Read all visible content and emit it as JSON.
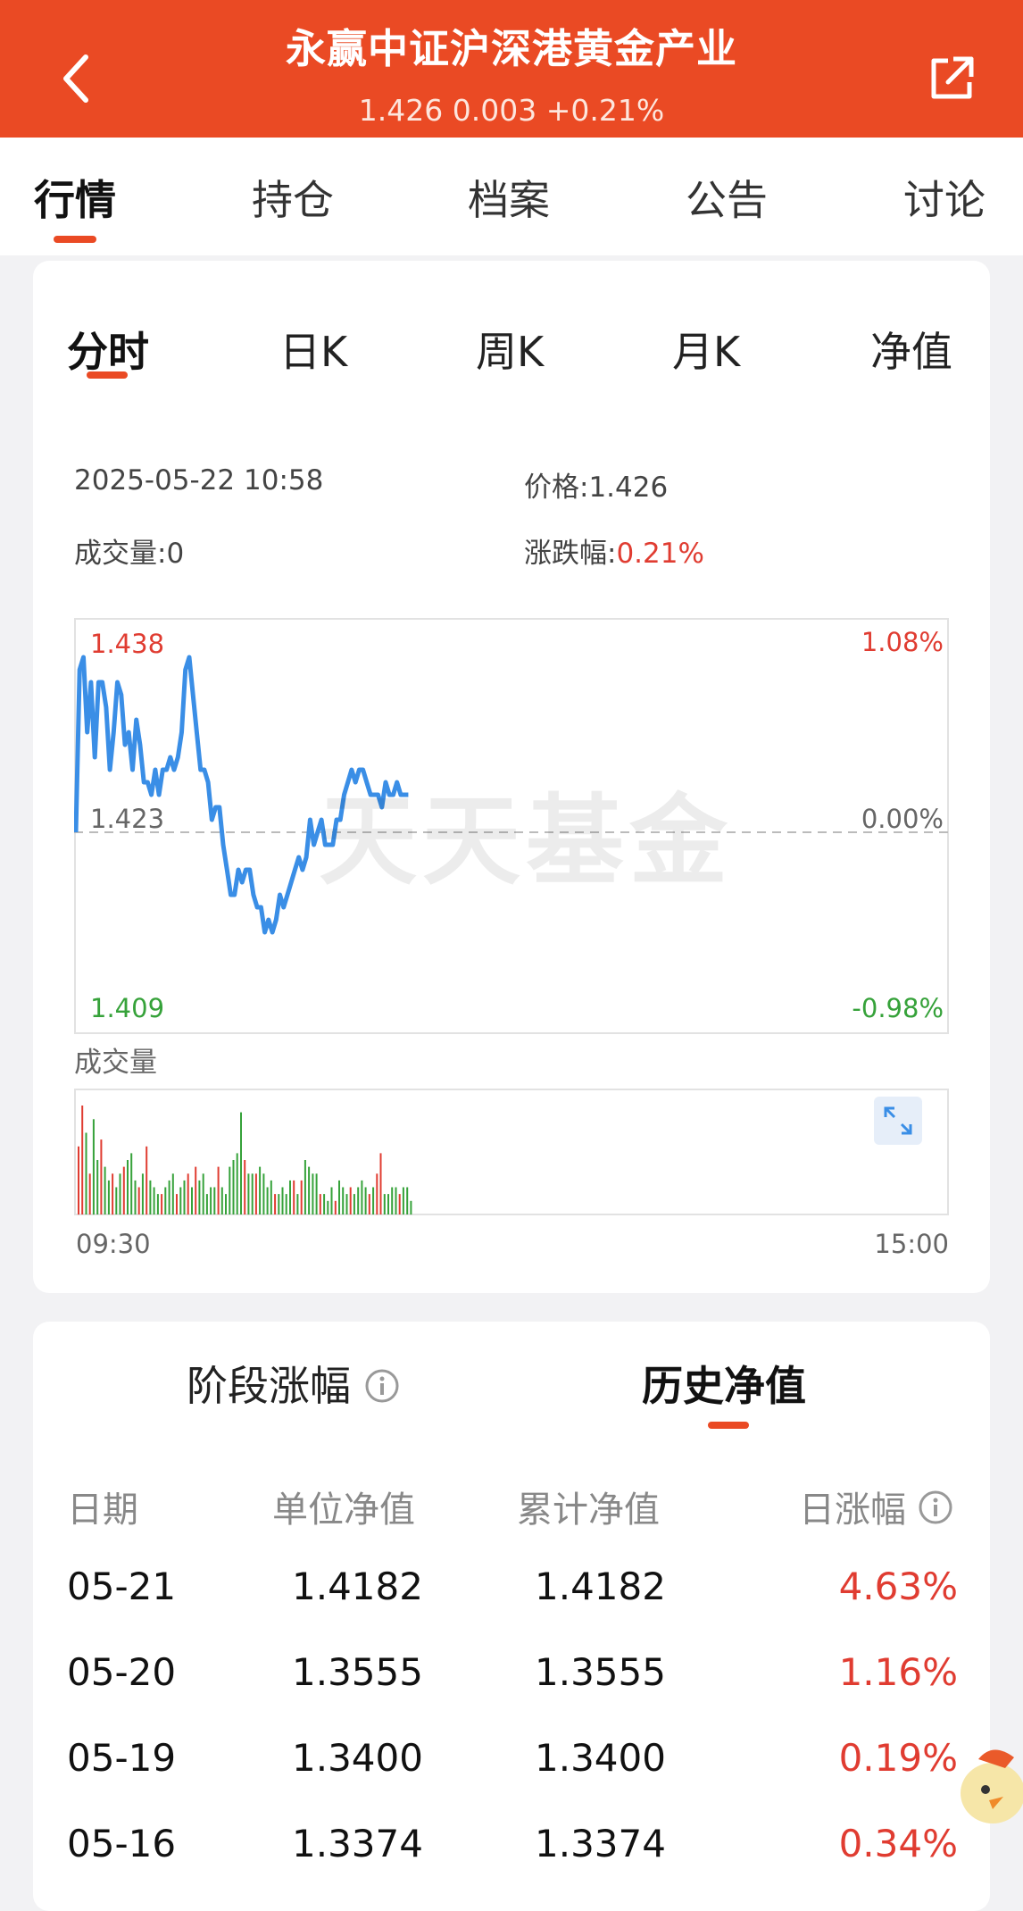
{
  "header": {
    "title": "永赢中证沪深港黄金产业",
    "subtitle": "1.426 0.003 +0.21%"
  },
  "main_tabs": [
    {
      "label": "行情",
      "active": true
    },
    {
      "label": "持仓",
      "active": false
    },
    {
      "label": "档案",
      "active": false
    },
    {
      "label": "公告",
      "active": false
    },
    {
      "label": "讨论",
      "active": false
    }
  ],
  "chart_tabs": [
    {
      "label": "分时",
      "active": true
    },
    {
      "label": "日K",
      "active": false
    },
    {
      "label": "周K",
      "active": false
    },
    {
      "label": "月K",
      "active": false
    },
    {
      "label": "净值",
      "active": false
    }
  ],
  "info": {
    "datetime": "2025-05-22 10:58",
    "price_label": "价格:",
    "price": "1.426",
    "volume_label": "成交量:",
    "volume": "0",
    "change_label": "涨跌幅:",
    "change": "0.21%"
  },
  "chart_labels": {
    "y_max": "1.438",
    "y_mid": "1.423",
    "y_min": "1.409",
    "pct_max": "1.08%",
    "pct_mid": "0.00%",
    "pct_min": "-0.98%",
    "volume_title": "成交量",
    "x_start": "09:30",
    "x_end": "15:00",
    "watermark": "天天基金"
  },
  "colors": {
    "brand": "#ea4a24",
    "line": "#3a8ee6",
    "up": "#e03c31",
    "down": "#36a23a"
  },
  "chart_data": {
    "type": "line",
    "x": [
      0,
      1,
      2,
      3,
      4,
      5,
      6,
      7,
      8,
      9,
      10,
      11,
      12,
      13,
      14,
      15,
      16,
      17,
      18,
      19,
      20,
      21,
      22,
      23,
      24,
      25,
      26,
      27,
      28,
      29,
      30,
      31,
      32,
      33,
      34,
      35,
      36,
      37,
      38,
      39,
      40,
      41,
      42,
      43,
      44,
      45,
      46,
      47,
      48,
      49,
      50,
      51,
      52,
      53,
      54,
      55,
      56,
      57,
      58,
      59,
      60,
      61,
      62,
      63,
      64,
      65,
      66,
      67,
      68,
      69,
      70,
      71,
      72,
      73,
      74,
      75,
      76,
      77,
      78,
      79,
      80,
      81,
      82,
      83,
      84,
      85,
      86,
      87,
      88
    ],
    "values": [
      1.423,
      1.436,
      1.437,
      1.431,
      1.435,
      1.429,
      1.435,
      1.435,
      1.433,
      1.428,
      1.431,
      1.435,
      1.434,
      1.43,
      1.431,
      1.428,
      1.432,
      1.43,
      1.427,
      1.427,
      1.426,
      1.428,
      1.426,
      1.428,
      1.428,
      1.429,
      1.428,
      1.429,
      1.431,
      1.436,
      1.437,
      1.434,
      1.431,
      1.428,
      1.428,
      1.427,
      1.424,
      1.425,
      1.425,
      1.422,
      1.42,
      1.418,
      1.418,
      1.42,
      1.419,
      1.42,
      1.42,
      1.418,
      1.417,
      1.417,
      1.415,
      1.416,
      1.415,
      1.416,
      1.418,
      1.417,
      1.418,
      1.419,
      1.42,
      1.421,
      1.42,
      1.421,
      1.424,
      1.422,
      1.423,
      1.424,
      1.422,
      1.422,
      1.422,
      1.424,
      1.424,
      1.426,
      1.427,
      1.428,
      1.427,
      1.428,
      1.428,
      1.427,
      1.426,
      1.426,
      1.426,
      1.425,
      1.427,
      1.426,
      1.426,
      1.427,
      1.426,
      1.426,
      1.426
    ],
    "ylim": [
      1.409,
      1.438
    ],
    "reference": 1.423,
    "x_range": [
      "09:30",
      "15:00"
    ],
    "volume": {
      "values": [
        50,
        80,
        60,
        30,
        70,
        40,
        55,
        35,
        25,
        30,
        20,
        30,
        35,
        40,
        45,
        25,
        20,
        30,
        50,
        25,
        20,
        15,
        15,
        20,
        25,
        30,
        15,
        20,
        25,
        30,
        20,
        35,
        25,
        30,
        15,
        20,
        20,
        35,
        20,
        15,
        35,
        40,
        45,
        75,
        40,
        30,
        30,
        30,
        35,
        30,
        20,
        25,
        15,
        15,
        20,
        15,
        25,
        25,
        15,
        25,
        40,
        35,
        30,
        30,
        15,
        15,
        10,
        20,
        10,
        25,
        20,
        15,
        20,
        15,
        20,
        25,
        20,
        15,
        20,
        30,
        45,
        15,
        15,
        20,
        20,
        15,
        20,
        20,
        10
      ],
      "colors": [
        "r",
        "r",
        "g",
        "r",
        "g",
        "g",
        "r",
        "g",
        "g",
        "r",
        "g",
        "g",
        "r",
        "g",
        "g",
        "g",
        "r",
        "g",
        "r",
        "g",
        "g",
        "g",
        "r",
        "g",
        "g",
        "g",
        "r",
        "g",
        "g",
        "r",
        "g",
        "r",
        "g",
        "g",
        "g",
        "g",
        "g",
        "r",
        "g",
        "g",
        "g",
        "g",
        "g",
        "g",
        "r",
        "g",
        "g",
        "r",
        "g",
        "g",
        "g",
        "g",
        "r",
        "g",
        "g",
        "g",
        "g",
        "r",
        "g",
        "r",
        "g",
        "g",
        "g",
        "g",
        "r",
        "g",
        "g",
        "g",
        "r",
        "g",
        "g",
        "g",
        "r",
        "g",
        "g",
        "g",
        "g",
        "r",
        "g",
        "r",
        "r",
        "g",
        "g",
        "g",
        "g",
        "r",
        "g",
        "g",
        "g"
      ]
    }
  },
  "history": {
    "tab_segment": "阶段涨幅",
    "tab_history": "历史净值",
    "columns": [
      "日期",
      "单位净值",
      "累计净值",
      "日涨幅"
    ],
    "rows": [
      {
        "date": "05-21",
        "unit": "1.4182",
        "acc": "1.4182",
        "pct": "4.63%"
      },
      {
        "date": "05-20",
        "unit": "1.3555",
        "acc": "1.3555",
        "pct": "1.16%"
      },
      {
        "date": "05-19",
        "unit": "1.3400",
        "acc": "1.3400",
        "pct": "0.19%"
      },
      {
        "date": "05-16",
        "unit": "1.3374",
        "acc": "1.3374",
        "pct": "0.34%"
      }
    ]
  }
}
